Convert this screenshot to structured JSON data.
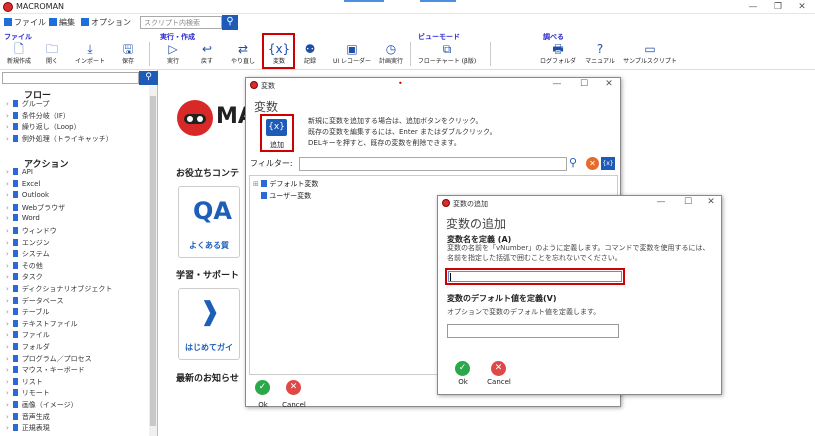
{
  "app": {
    "title": "MACROMAN"
  },
  "window_controls": {
    "minimize": "—",
    "maximize": "❐",
    "close": "✕"
  },
  "menu": {
    "file": "ファイル",
    "edit": "編集",
    "options": "オプション"
  },
  "search": {
    "placeholder": "スクリプト内検索"
  },
  "ribbon": {
    "groups": {
      "file": "ファイル",
      "run": "実行・作成",
      "view": "ビューモード",
      "learn": "調べる"
    },
    "buttons": {
      "new": "新規作成",
      "open": "開く",
      "import": "インポート",
      "save": "保存",
      "run": "実行",
      "undo": "戻す",
      "redo": "やり直し",
      "variable": "変数",
      "record": "記録",
      "uirecorder": "UI レコーダー",
      "schedule": "計画実行",
      "flowchart": "フローチャート (β版)",
      "logfolder": "ログフォルダ",
      "manual": "マニュアル",
      "sample": "サンプルスクリプト"
    }
  },
  "left": {
    "flow_title": "フロー",
    "flow_items": [
      "グループ",
      "条件分岐（IF）",
      "繰り返し（Loop）",
      "例外処理（トライキャッチ）"
    ],
    "action_title": "アクション",
    "action_items": [
      "API",
      "Excel",
      "Outlook",
      "Webブラウザ",
      "Word",
      "ウィンドウ",
      "エンジン",
      "システム",
      "その他",
      "タスク",
      "ディクショナリオブジェクト",
      "データベース",
      "テーブル",
      "テキストファイル",
      "ファイル",
      "フォルダ",
      "プログラム／プロセス",
      "マウス・キーボード",
      "リスト",
      "リモート",
      "画像（イメージ）",
      "音声生成",
      "正規表現"
    ]
  },
  "main": {
    "logo_text": "MA",
    "sections": {
      "useful": "お役立ちコンテ",
      "learn": "学習・サポート",
      "news": "最新のお知らせ"
    },
    "cards": {
      "faq": "よくある質",
      "start": "はじめてガイ"
    }
  },
  "var_window": {
    "title": "変数",
    "heading": "変数",
    "add_label": "追加",
    "desc_lines": [
      "新規に変数を追加する場合は、追加ボタンをクリック。",
      "既存の変数を編集するには、Enter またはダブルクリック。",
      "DELキーを押すと、既存の変数を削除できます。"
    ],
    "filter_label": "フィルター:",
    "filter_value": "",
    "tree": [
      "デフォルト変数",
      "ユーザー変数"
    ],
    "ok": "Ok",
    "cancel": "Cancel"
  },
  "add_window": {
    "title": "変数の追加",
    "heading": "変数の追加",
    "name_label": "変数名を定義 (A)",
    "name_desc": "変数の名前を「vNumber」のように定義します。コマンドで変数を使用するには、名前を指定した括弧で囲むことを忘れないでください。",
    "name_value": "",
    "default_label": "変数のデフォルト値を定義(V)",
    "default_desc": "オプションで変数のデフォルト値を定義します。",
    "default_value": "",
    "ok": "Ok",
    "cancel": "Cancel"
  },
  "colors": {
    "accent": "#1e5ab8",
    "highlight": "#d00000",
    "ok": "#2aa84a",
    "cancel": "#e04848"
  }
}
